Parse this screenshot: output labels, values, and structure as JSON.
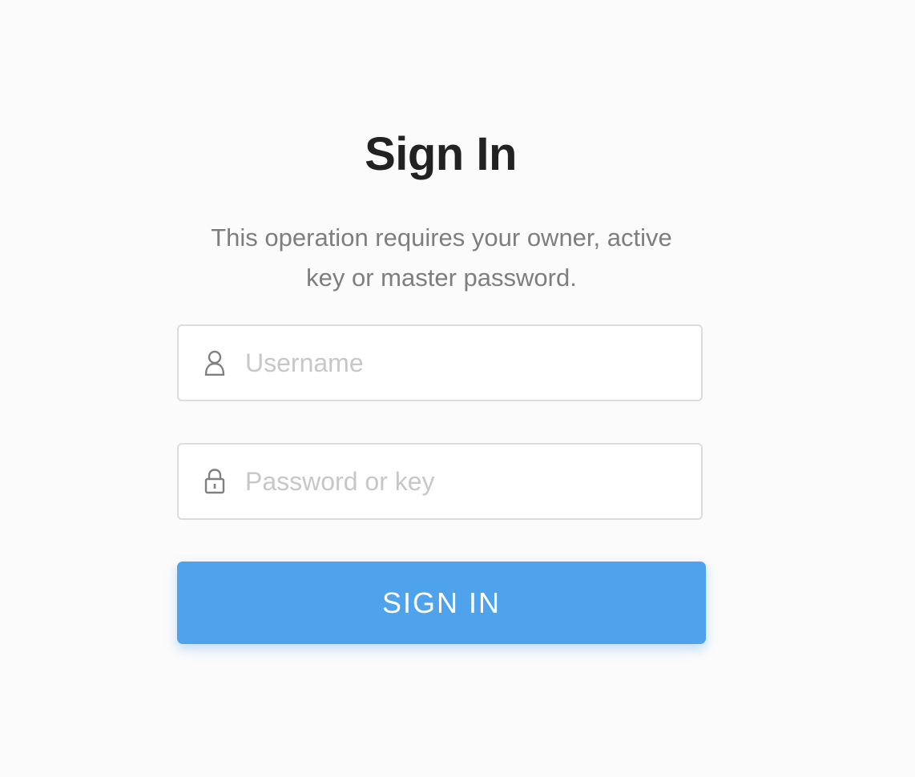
{
  "colors": {
    "background": "#fbfbfb",
    "title": "#222222",
    "subtitle": "#7e7e7e",
    "placeholder": "#c7c7c7",
    "field_border": "#dcdcdc",
    "accent": "#4ea3ec",
    "button_text": "#ffffff"
  },
  "title": "Sign In",
  "subtitle_line1": "This operation requires your owner, active",
  "subtitle_line2": "key or master password.",
  "username": {
    "icon": "user-icon",
    "placeholder": "Username",
    "value": ""
  },
  "password": {
    "icon": "lock-icon",
    "placeholder": "Password or key",
    "value": ""
  },
  "submit": {
    "label": "SIGN IN"
  }
}
